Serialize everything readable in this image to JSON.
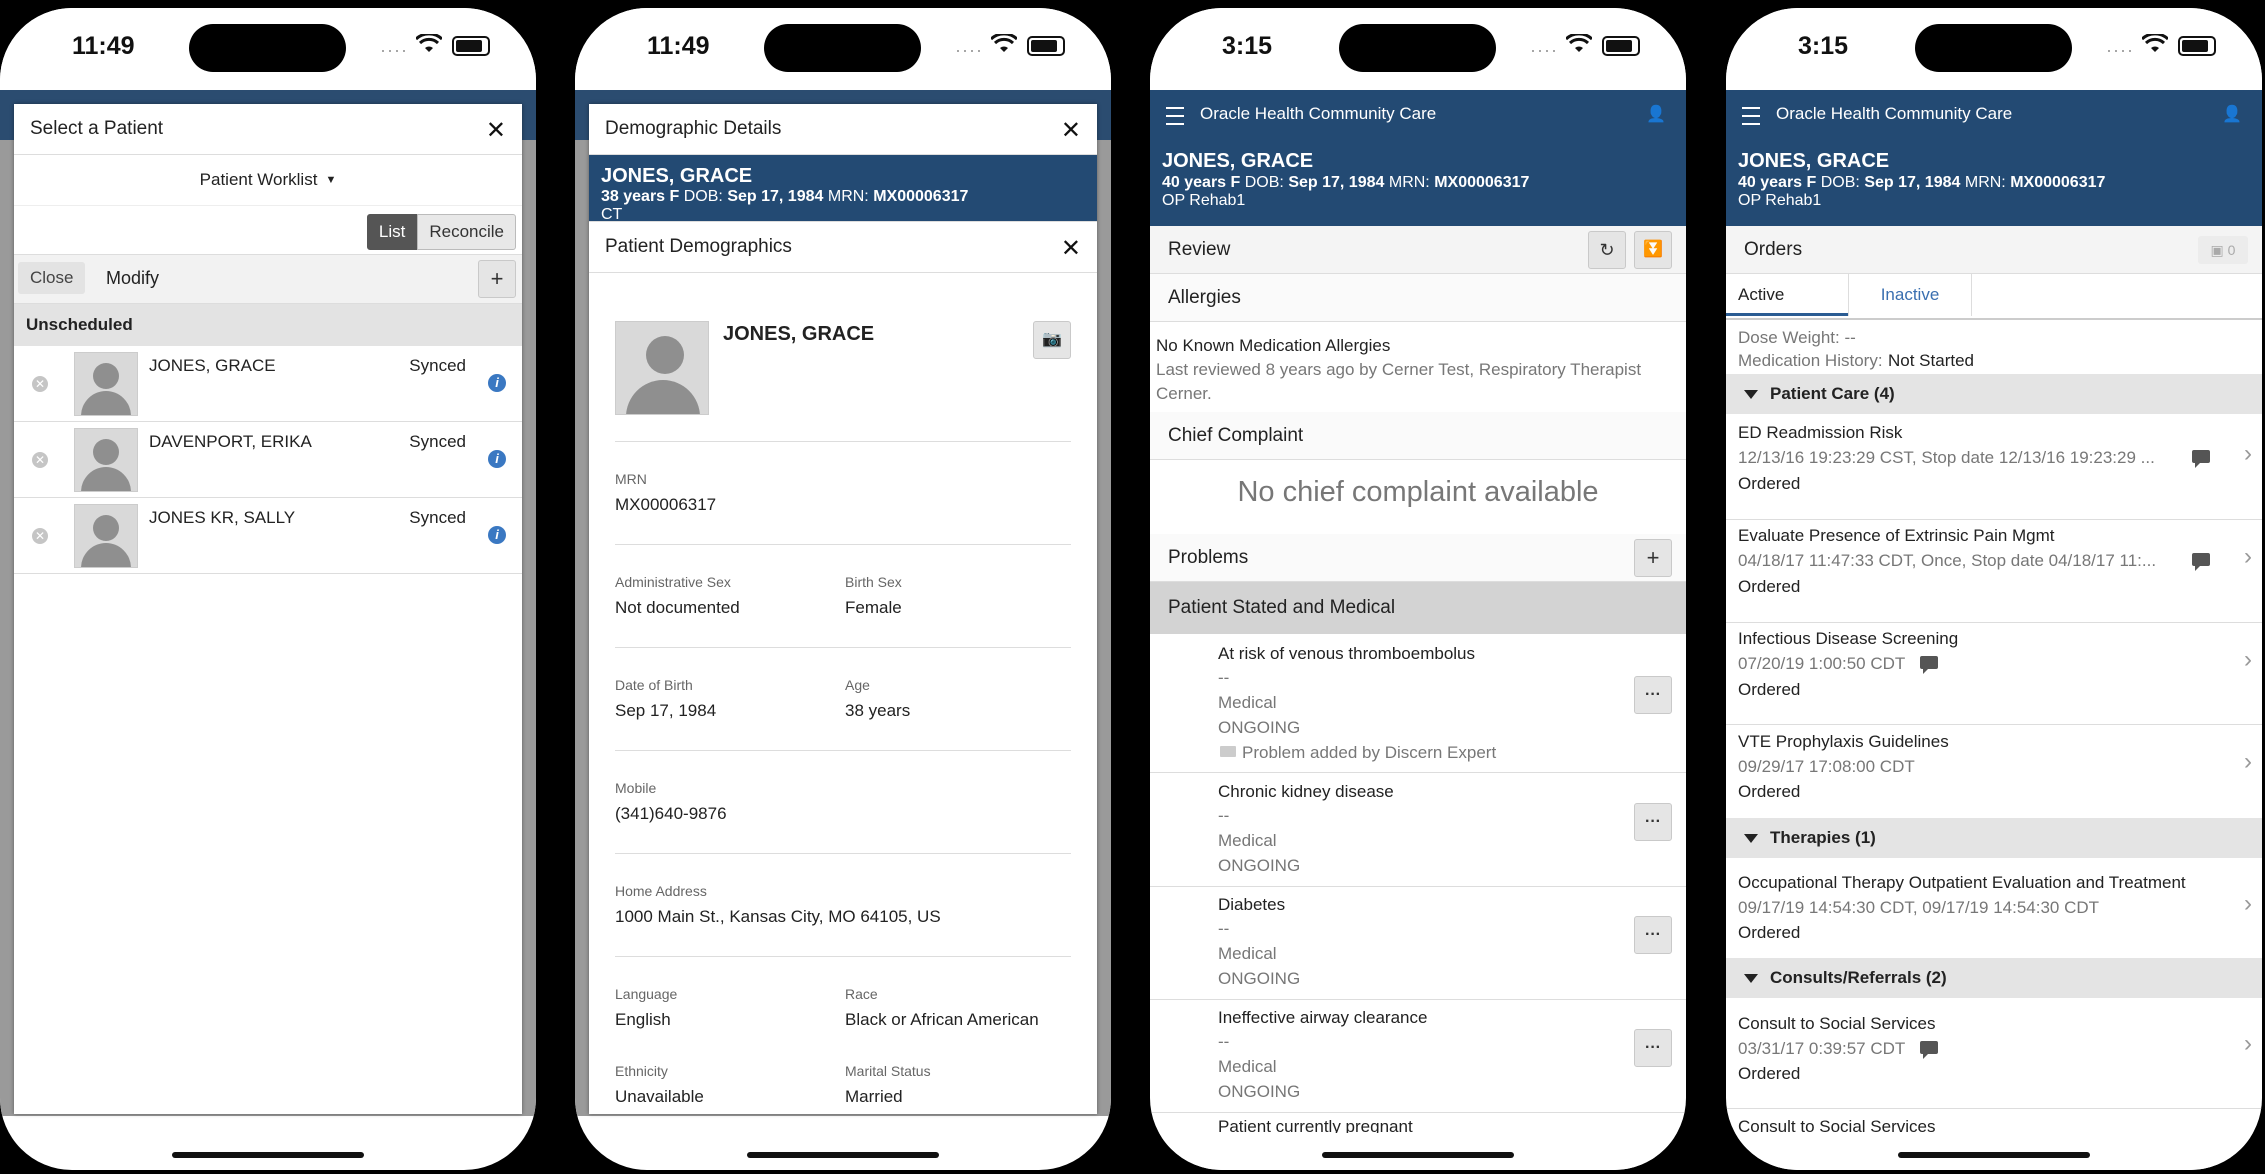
{
  "phone1": {
    "time": "11:49",
    "modal_title": "Select a Patient",
    "worklist_label": "Patient Worklist",
    "seg_list": "List",
    "seg_reconcile": "Reconcile",
    "close_label": "Close",
    "modify_label": "Modify",
    "section": "Unscheduled",
    "patients": [
      {
        "name": "JONES, GRACE",
        "status": "Synced"
      },
      {
        "name": "DAVENPORT, ERIKA",
        "status": "Synced"
      },
      {
        "name": "JONES KR, SALLY",
        "status": "Synced"
      }
    ]
  },
  "phone2": {
    "time": "11:49",
    "modal_title": "Demographic Details",
    "patient_name": "JONES, GRACE",
    "patient_line1_a": "38 years",
    "patient_line1_b": "F",
    "patient_line1_c": "DOB:",
    "patient_line1_d": "Sep 17, 1984",
    "patient_line1_e": "MRN:",
    "patient_line1_f": "MX00006317",
    "patient_line2": "CT",
    "sub_title": "Patient Demographics",
    "card_name": "JONES, GRACE",
    "fields": {
      "mrn_label": "MRN",
      "mrn": "MX00006317",
      "admin_sex_label": "Administrative Sex",
      "admin_sex": "Not documented",
      "birth_sex_label": "Birth Sex",
      "birth_sex": "Female",
      "dob_label": "Date of Birth",
      "dob": "Sep 17, 1984",
      "age_label": "Age",
      "age": "38 years",
      "mobile_label": "Mobile",
      "mobile": "(341)640-9876",
      "address_label": "Home Address",
      "address": "1000 Main St., Kansas City, MO 64105, US",
      "language_label": "Language",
      "language": "English",
      "race_label": "Race",
      "race": "Black or African American",
      "ethnicity_label": "Ethnicity",
      "ethnicity": "Unavailable",
      "marital_label": "Marital Status",
      "marital": "Married"
    }
  },
  "phone3": {
    "time": "3:15",
    "app_title": "Oracle Health Community Care",
    "patient_name": "JONES, GRACE",
    "line2_a": "40 years",
    "line2_b": "F",
    "line2_c": "DOB:",
    "line2_d": "Sep 17, 1984",
    "line2_e": "MRN:",
    "line2_f": "MX00006317",
    "line3": "OP Rehab1",
    "review": "Review",
    "allergies": "Allergies",
    "allergy_text": "No Known Medication Allergies",
    "allergy_review1": "Last reviewed 8 years ago by Cerner Test, Respiratory Therapist",
    "allergy_review2": "Cerner.",
    "chief_complaint": "Chief Complaint",
    "no_complaint": "No chief complaint available",
    "problems": "Problems",
    "problem_group": "Patient Stated and Medical",
    "problem_items": [
      {
        "name": "At risk of venous thromboembolus",
        "dash": "--",
        "type": "Medical",
        "status": "ONGOING",
        "note": "Problem added by Discern Expert"
      },
      {
        "name": "Chronic kidney disease",
        "dash": "--",
        "type": "Medical",
        "status": "ONGOING"
      },
      {
        "name": "Diabetes",
        "dash": "--",
        "type": "Medical",
        "status": "ONGOING"
      },
      {
        "name": "Ineffective airway clearance",
        "dash": "--",
        "type": "Medical",
        "status": "ONGOING"
      },
      {
        "name": "Patient currently pregnant"
      }
    ]
  },
  "phone4": {
    "time": "3:15",
    "app_title": "Oracle Health Community Care",
    "patient_name": "JONES, GRACE",
    "line2_a": "40 years",
    "line2_b": "F",
    "line2_c": "DOB:",
    "line2_d": "Sep 17, 1984",
    "line2_e": "MRN:",
    "line2_f": "MX00006317",
    "line3": "OP Rehab1",
    "orders": "Orders",
    "orders_count": "0",
    "tab_active": "Active",
    "tab_inactive": "Inactive",
    "dose_weight": "Dose Weight: --",
    "med_history_label": "Medication History:",
    "med_history_val": "Not Started",
    "groups": {
      "patient_care": "Patient Care (4)",
      "therapies": "Therapies (1)",
      "consults": "Consults/Referrals (2)"
    },
    "orders_list": [
      {
        "name": "ED Readmission Risk",
        "detail": "12/13/16 19:23:29 CST, Stop date 12/13/16 19:23:29 ...",
        "status": "Ordered"
      },
      {
        "name": "Evaluate Presence of Extrinsic Pain Mgmt",
        "detail": "04/18/17 11:47:33 CDT, Once, Stop date 04/18/17 11:...",
        "status": "Ordered"
      },
      {
        "name": "Infectious Disease Screening",
        "detail": "07/20/19 1:00:50 CDT",
        "status": "Ordered"
      },
      {
        "name": "VTE Prophylaxis Guidelines",
        "detail": "09/29/17 17:08:00 CDT",
        "status": "Ordered"
      },
      {
        "name": "Occupational Therapy Outpatient Evaluation and Treatment",
        "detail": "09/17/19 14:54:30 CDT, 09/17/19 14:54:30 CDT",
        "status": "Ordered"
      },
      {
        "name": "Consult to Social Services",
        "detail": "03/31/17 0:39:57 CDT",
        "status": "Ordered"
      },
      {
        "name": "Consult to Social Services"
      }
    ]
  }
}
